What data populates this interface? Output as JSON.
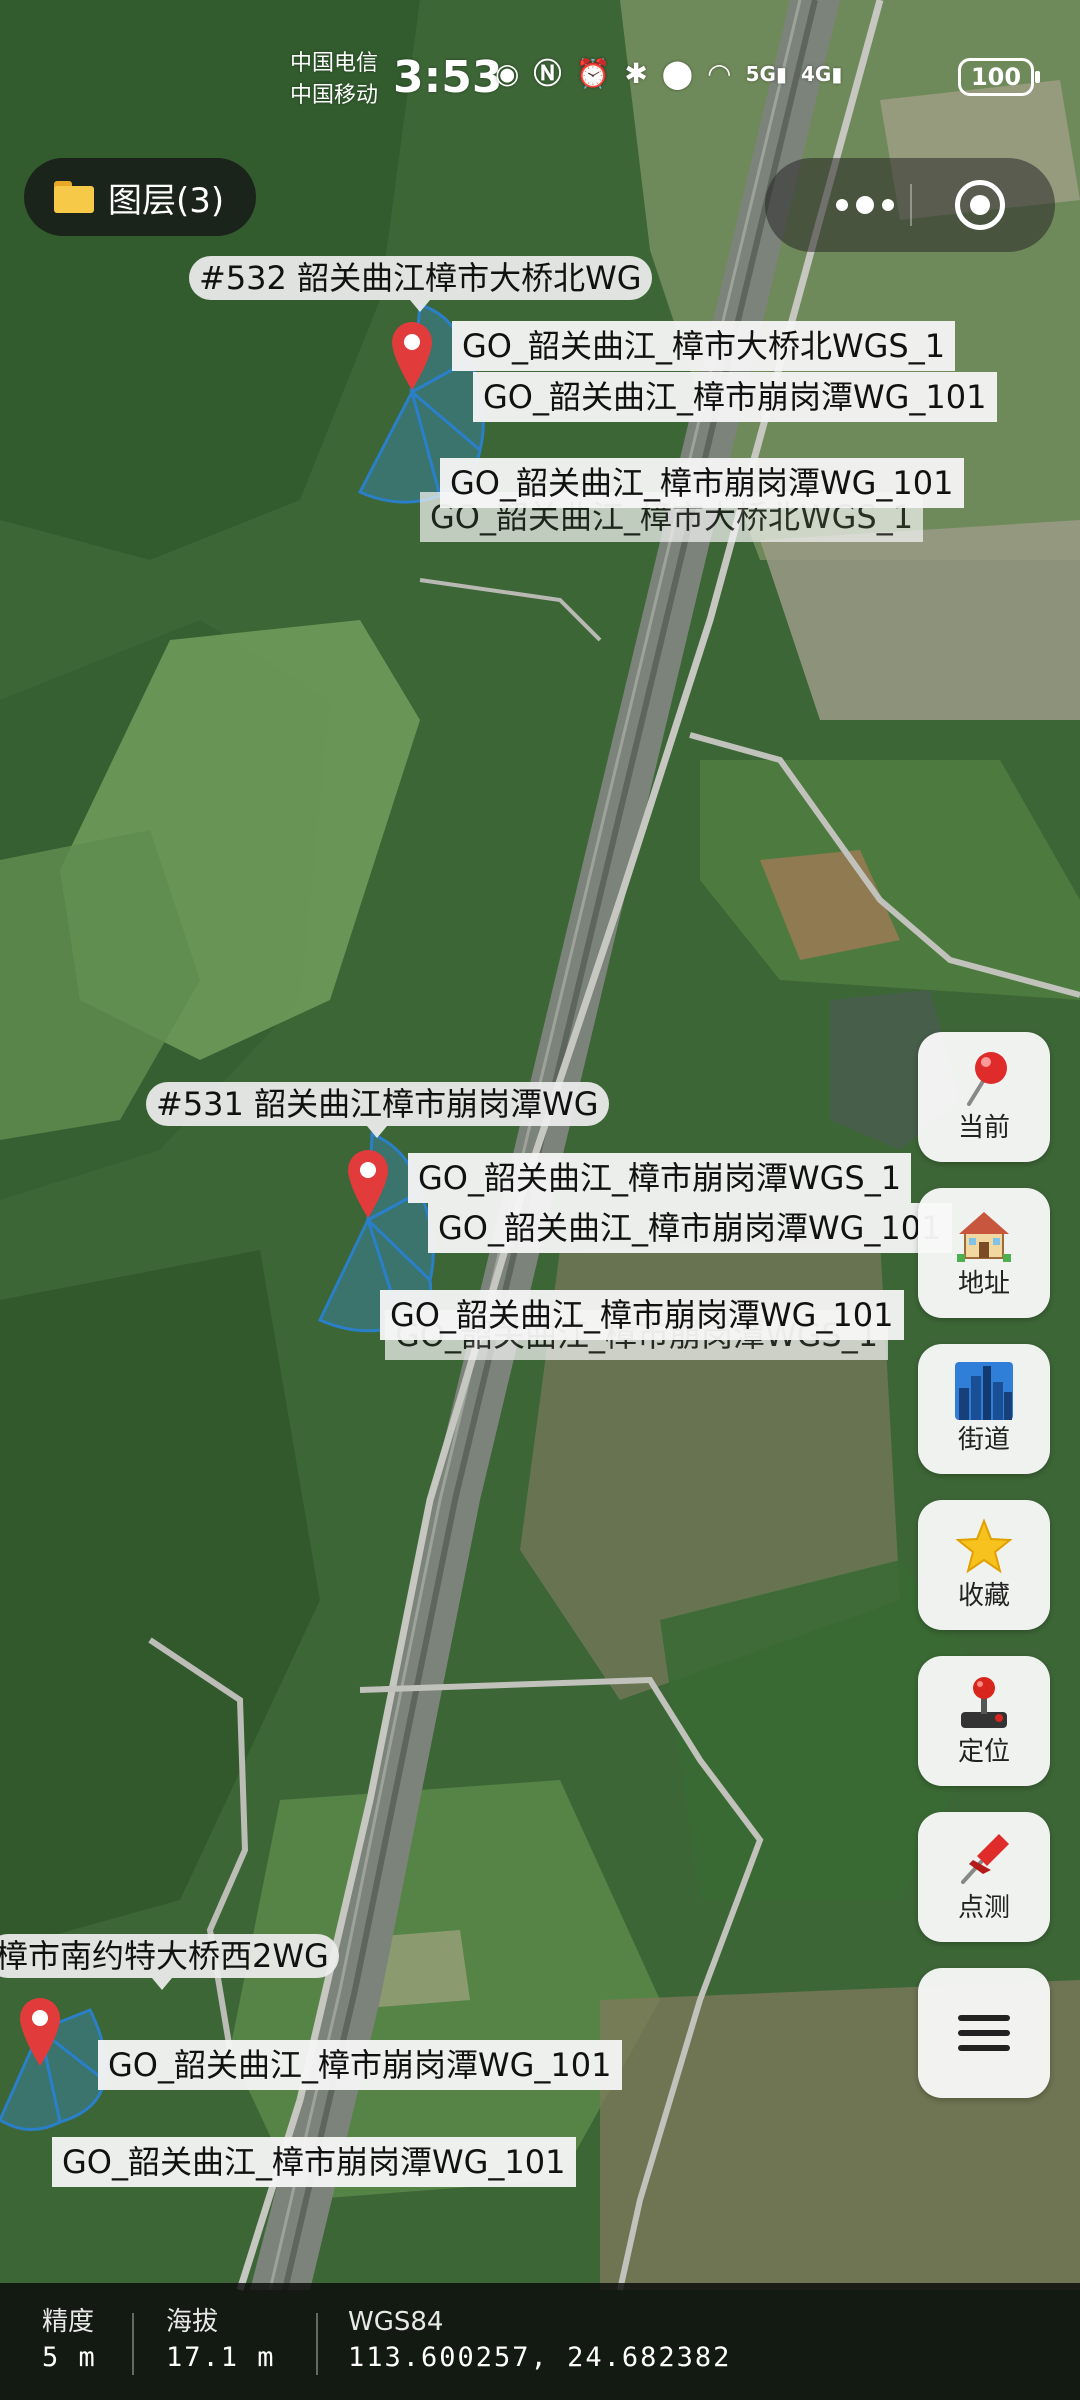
{
  "status_bar": {
    "carrier_1": "中国电信",
    "carrier_2": "中国移动",
    "time": "3:53",
    "icons": [
      "eye-icon",
      "nfc-icon",
      "alarm-icon",
      "bluetooth-icon",
      "location-icon",
      "wifi-icon",
      "5g-signal-icon",
      "4g-signal-icon"
    ],
    "signal_1": "5G",
    "signal_2": "4G",
    "battery": "100"
  },
  "layers_button": {
    "label": "图层(3)"
  },
  "map": {
    "sites": [
      {
        "title": "#532 韶关曲江樟市大桥北WG",
        "cells": [
          "GO_韶关曲江_樟市大桥北WGS_1",
          "GO_韶关曲江_樟市崩岗潭WG_101",
          "GO_韶关曲江_樟市崩岗潭WG_101"
        ]
      },
      {
        "title": "#531 韶关曲江樟市崩岗潭WG",
        "cells": [
          "GO_韶关曲江_樟市崩岗潭WGS_1",
          "GO_韶关曲江_樟市崩岗潭WG_101",
          "GO_韶关曲江_樟市崩岗潭WG_101"
        ]
      },
      {
        "title": "樟市南约特大桥西2WG",
        "cells": [
          "GO_韶关曲江_樟市崩岗潭WG_101",
          "GO_韶关曲江_樟市崩岗潭WG_101"
        ]
      }
    ]
  },
  "tools": [
    {
      "label": "当前",
      "icon": "pushpin-current-icon"
    },
    {
      "label": "地址",
      "icon": "house-address-icon"
    },
    {
      "label": "街道",
      "icon": "cityscape-street-icon"
    },
    {
      "label": "收藏",
      "icon": "star-favorite-icon"
    },
    {
      "label": "定位",
      "icon": "joystick-locate-icon"
    },
    {
      "label": "点测",
      "icon": "pin-point-test-icon"
    },
    {
      "label": "",
      "icon": "menu-icon"
    }
  ],
  "info_bar": {
    "accuracy_label": "精度",
    "accuracy_value": "5 m",
    "altitude_label": "海拔",
    "altitude_value": "17.1 m",
    "coord_label": "WGS84",
    "coord_value": "113.600257, 24.682382"
  },
  "colors": {
    "sector_fill": "#3a8fd1",
    "pin_red": "#e23b3b",
    "rail": "#8a8f8a"
  }
}
